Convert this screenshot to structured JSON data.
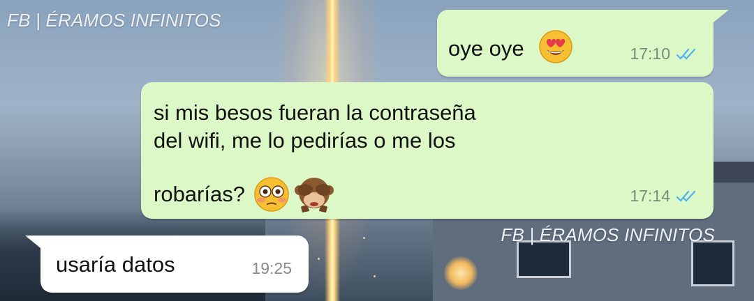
{
  "watermarks": {
    "top": "FB | ÉRAMOS INFINITOS",
    "middle": "FB | ÉRAMOS INFINITOS"
  },
  "messages": [
    {
      "direction": "outgoing",
      "lines": [
        "oye oye"
      ],
      "emojis": [
        "heart-eyes-emoji"
      ],
      "time": "17:10",
      "status": "read"
    },
    {
      "direction": "outgoing",
      "lines": [
        "si mis besos fueran la contraseña",
        "del wifi, me lo pedirías o me los",
        "robarías?"
      ],
      "emojis": [
        "flushed-face-emoji",
        "see-no-evil-monkey-emoji"
      ],
      "time": "17:14",
      "status": "read"
    },
    {
      "direction": "incoming",
      "lines": [
        "usaría datos"
      ],
      "emojis": [],
      "time": "19:25",
      "status": "received"
    }
  ],
  "colors": {
    "outgoing_bubble": "#dcf8c6",
    "incoming_bubble": "#ffffff",
    "read_ticks": "#4fb3f0"
  }
}
